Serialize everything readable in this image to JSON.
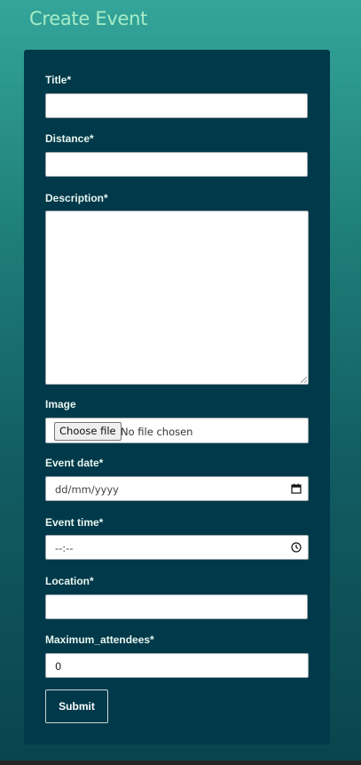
{
  "page": {
    "title": "Create Event"
  },
  "form": {
    "title_label": "Title*",
    "distance_label": "Distance*",
    "description_label": "Description*",
    "image_label": "Image",
    "image_button_label": "Choose file",
    "image_status": "No file chosen",
    "event_date_label": "Event date*",
    "event_date_placeholder": "dd/mm/yyyy",
    "event_time_label": "Event time*",
    "event_time_placeholder": "--:--",
    "location_label": "Location*",
    "max_attendees_label": "Maximum_attendees*",
    "max_attendees_value": "0",
    "submit_label": "Submit"
  },
  "icons": {
    "date_picker": "calendar-icon",
    "time_picker": "clock-icon"
  },
  "colors": {
    "title_text": "#a6ecc6",
    "card_background": "#00394a",
    "gradient_top": "#34a59a",
    "gradient_bottom": "#0a444c"
  }
}
